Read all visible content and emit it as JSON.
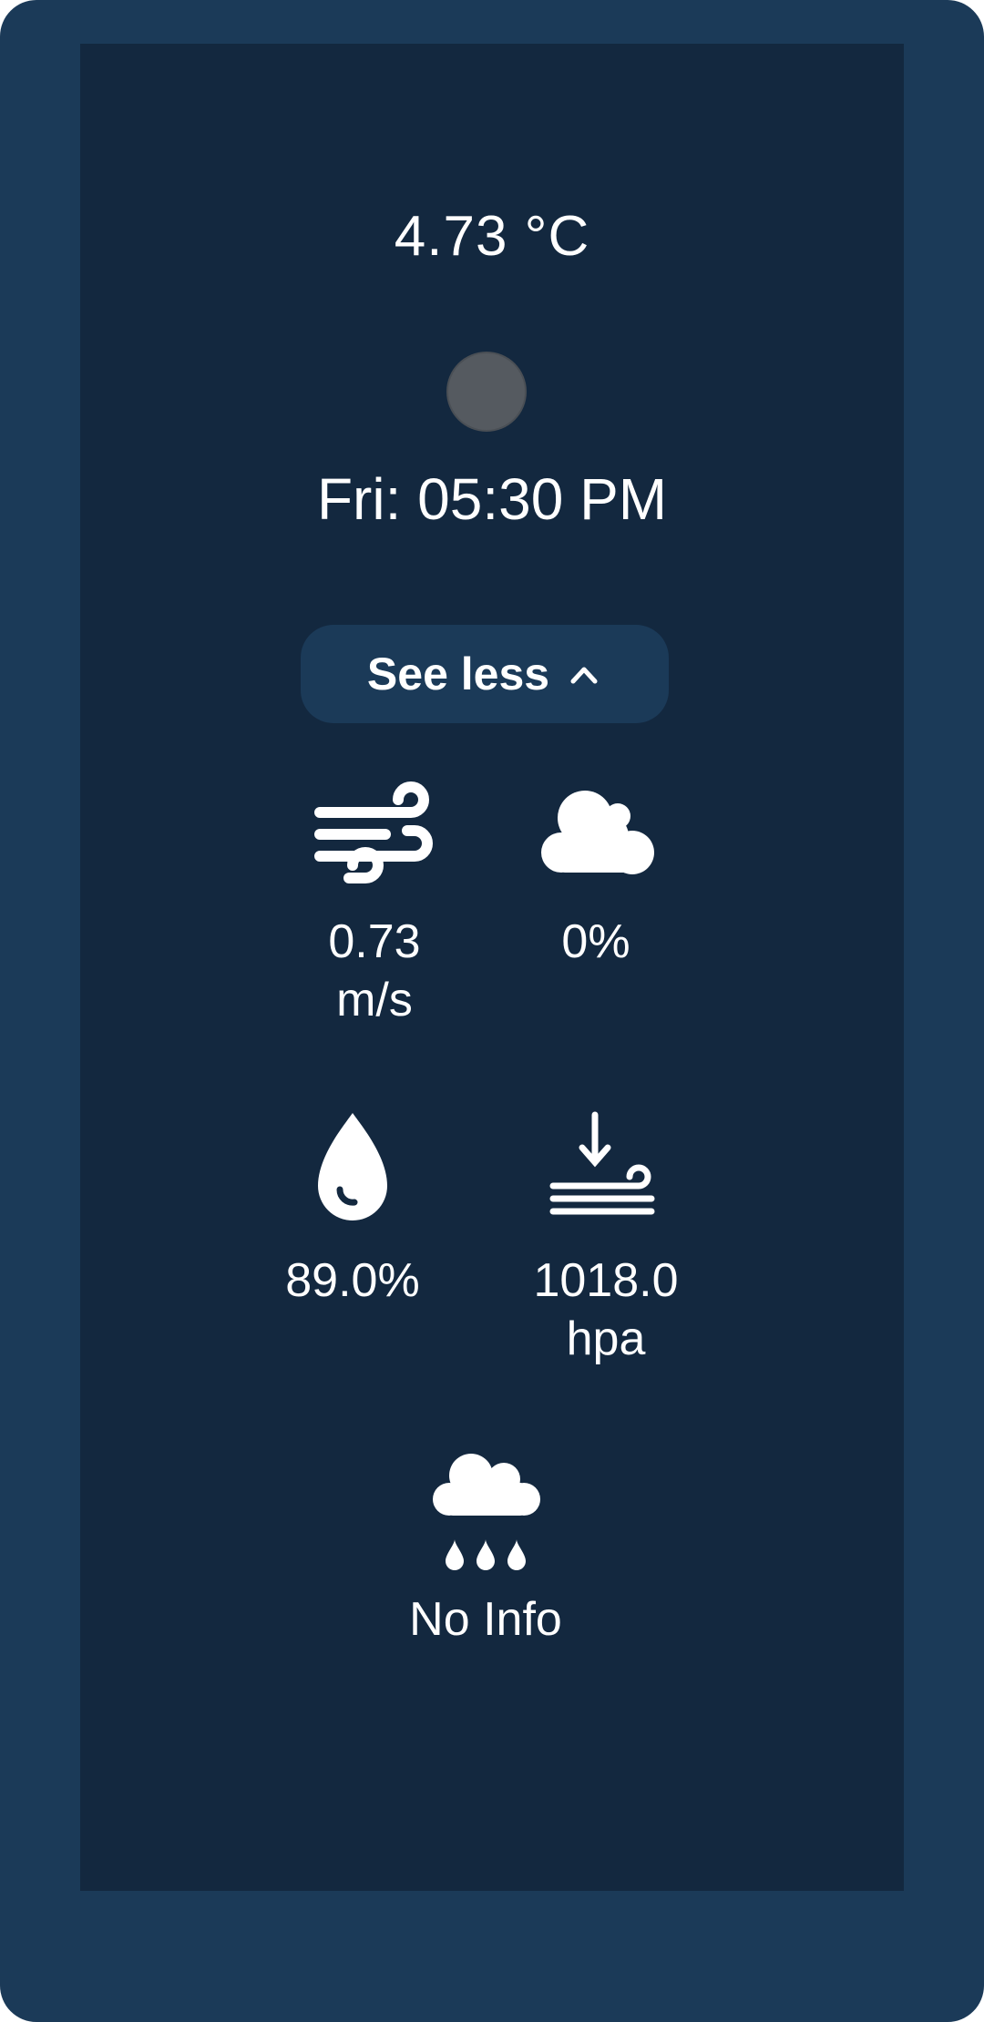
{
  "weather": {
    "temperature": "4.73 °C",
    "condition_icon": "weather-condition-icon",
    "datetime": "Fri: 05:30 PM"
  },
  "toggle": {
    "label": "See less",
    "icon": "chevron-up-icon"
  },
  "metrics": {
    "wind": {
      "icon": "wind-icon",
      "value": "0.73\nm/s"
    },
    "clouds": {
      "icon": "cloud-icon",
      "value": "0%"
    },
    "humidity": {
      "icon": "humidity-drop-icon",
      "value": "89.0%"
    },
    "pressure": {
      "icon": "pressure-icon",
      "value": "1018.0\nhpa"
    },
    "rain": {
      "icon": "rain-cloud-icon",
      "value": "No Info"
    }
  },
  "colors": {
    "frame": "#1b3a58",
    "panel": "#13283f",
    "button": "#1b3a58",
    "text": "#ffffff",
    "condition_icon": "#555a60"
  }
}
